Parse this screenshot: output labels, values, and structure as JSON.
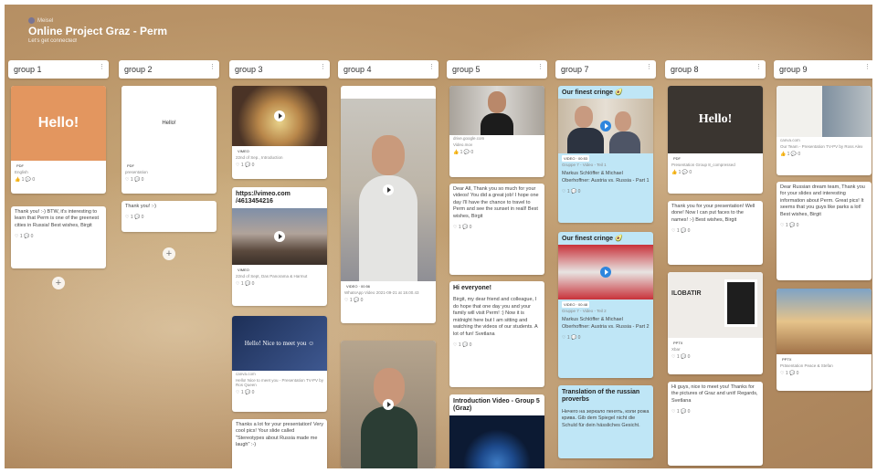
{
  "header": {
    "meta": "Meisel",
    "title": "Online Project Graz - Perm",
    "subtitle": "Let's get connected!"
  },
  "columns": [
    {
      "name": "group 1"
    },
    {
      "name": "group 2"
    },
    {
      "name": "group 3"
    },
    {
      "name": "group 4"
    },
    {
      "name": "group 5"
    },
    {
      "name": "group 7"
    },
    {
      "name": "group 8"
    },
    {
      "name": "group 9"
    }
  ],
  "cards": {
    "g1_hello": {
      "label": "Hello!",
      "tag": "PDF",
      "meta": "English",
      "react": "👍 1 💬 0"
    },
    "g1_text": {
      "body": "Thank you! :-) BTW, it's interesting to learn that Perm is one of the greenest cities in Russia! Best wishes, Birgit",
      "react": "♡ 1 💬 0"
    },
    "g2_hello": {
      "label": "Hello!",
      "tag": "PDF",
      "meta": "presentation",
      "react": "♡ 1 💬 0"
    },
    "g2_text": {
      "body": "Thank you! :-)",
      "react": "♡ 1 💬 0"
    },
    "g3_food": {
      "tag": "VIMEO",
      "meta": "22nd of Sep., Introduction",
      "react": "♡ 1 💬 0"
    },
    "g3_vimeo": {
      "title": "https://vimeo.com /4613454216",
      "tag": "VIMEO",
      "meta": "22nd of Sept, Das Panorama & Harmut",
      "react": "♡ 1 💬 0"
    },
    "g3_canva": {
      "label": "Hello! Nice to meet you ☺",
      "meta": "canva.com",
      "meta2": "Hello! Nice to meet you - Presentation TV-PV by Ros Queen",
      "react": "♡ 1 💬 0"
    },
    "g3_text": {
      "body": "Thanks a lot for your presentation! Very cool pics! Your slide called \"Stereotypes about Russia made me laugh\" :-)"
    },
    "g4_video1": {
      "tag": "VIDEO · 00:56",
      "meta": "WhatsApp Video 2021-09-21 at 18.00.43",
      "react": "♡ 1 💬 0"
    },
    "g4_video2": {},
    "g5_video": {
      "meta": "drive.google.com",
      "meta2": "Video.mov",
      "react": "👍 1 💬 0"
    },
    "g5_text1": {
      "body": "Dear All, Thank you so much for your videos! You did a great job! I hope one day I'll have the chance to travel to Perm and see the sunset in reall! Best wishes, Birgit",
      "react": "♡ 1 💬 0"
    },
    "g5_text2": {
      "title": "Hi everyone!",
      "body": "Birgit, my dear friend and colleague, I do hope that one day you and your family will visit Perm! :) Now it is midnight here but I am sitting and watching the videos of our students. A lot of fun! Svetlana",
      "react": "♡ 1 💬 0"
    },
    "g5_intro": {
      "title": "Introduction Video - Group 5 (Graz)"
    },
    "g7_cringe1": {
      "title": "Our finest cringe 🥑",
      "tag": "VIDEO · 00:53",
      "meta": "Gruppe 7 - Video - Teil 1",
      "body": "Markus Schlöffer & Michael Oberhoffner: Austria vs. Russia - Part 1",
      "react": "♡ 1 💬 0"
    },
    "g7_cringe2": {
      "title": "Our finest cringe 🥑",
      "tag": "VIDEO · 00:48",
      "meta": "Gruppe 7 - Video - Teil 2",
      "body": "Markus Schlöffer & Michael Oberhoffner: Austria vs. Russia - Part 2",
      "react": "♡ 1 💬 0"
    },
    "g7_proverbs": {
      "title": "Translation of the russian proverbs",
      "body": "Нечего на зеркало пенять, коли рожа крива. Gib dem Spiegel nicht die Schuld für dein hässliches Gesicht."
    },
    "g8_hello": {
      "label": "Hello!",
      "tag": "PDF",
      "meta": "Presentation Group 8_compressed",
      "react": "👍 1 💬 0"
    },
    "g8_text1": {
      "body": "Thank you for your presentation! Well done! Now I can put faces to the names! :-) Best wishes, Birgit",
      "react": "♡ 1 💬 0"
    },
    "g8_pptx": {
      "label": "ILOBATIR",
      "tag": "PPTX",
      "meta": "Xbar",
      "react": "♡ 1 💬 0"
    },
    "g8_text2": {
      "body": "Hi guys, nice to meet you! Thanks for the pictures of Graz and unit! Regards, Svetlana",
      "react": "♡ 1 💬 0"
    },
    "g9_canva": {
      "meta": "canva.com",
      "meta2": "Our Team - Presentation TV-PV by Ross Alex",
      "react": "👍 1 💬 0"
    },
    "g9_text": {
      "body": "Dear Russian dream team, Thank you for your slides and interesting information about Perm. Great pics! It seems that you guys like parks a lot! Best wishes, Birgit",
      "react": "♡ 1 💬 0"
    },
    "g9_pptx": {
      "tag": "PPTX",
      "meta": "Präsentation Peace & Stefan",
      "react": "♡ 1 💬 0"
    }
  },
  "colors": {
    "blue_card": "#bfe6f6",
    "board": "#b89266"
  }
}
